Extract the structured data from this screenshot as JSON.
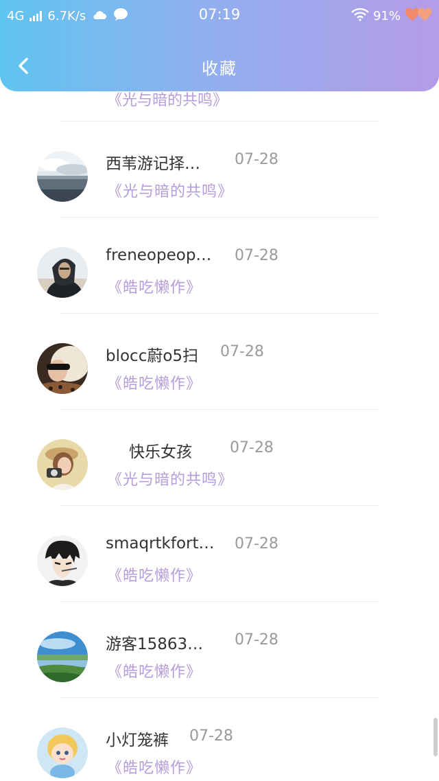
{
  "status_bar": {
    "network": "4G",
    "speed": "6.7K/s",
    "time": "07:19",
    "battery": "91%"
  },
  "header": {
    "title": "收藏"
  },
  "partial_item": {
    "title": "《光与暗的共鸣》"
  },
  "items": [
    {
      "name": "西苇游记择…",
      "date": "07-28",
      "title": "《光与暗的共鸣》",
      "avatar": "ocean-sky-photo"
    },
    {
      "name": "freneopeop…",
      "date": "07-28",
      "title": "《皓吃懒作》",
      "avatar": "hooded-man-photo"
    },
    {
      "name": "blocc蔚o5扫",
      "date": "07-28",
      "title": "《皓吃懒作》",
      "avatar": "woman-sunglasses-photo"
    },
    {
      "name": "快乐女孩",
      "date": "07-28",
      "title": "《光与暗的共鸣》",
      "avatar": "girl-with-camera-photo"
    },
    {
      "name": "smaqrtkfort…",
      "date": "07-28",
      "title": "《皓吃懒作》",
      "avatar": "anime-boy-drawing"
    },
    {
      "name": "游客15863…",
      "date": "07-28",
      "title": "《皓吃懒作》",
      "avatar": "coastal-landscape-photo"
    },
    {
      "name": "小灯笼裤",
      "date": "07-28",
      "title": "《皓吃懒作》",
      "avatar": "cartoon-girl-drawing"
    }
  ],
  "colors": {
    "header_gradient_start": "#5fc4f0",
    "header_gradient_end": "#b59be8",
    "book_title": "#b59ddb",
    "date": "#9a9a9a"
  }
}
